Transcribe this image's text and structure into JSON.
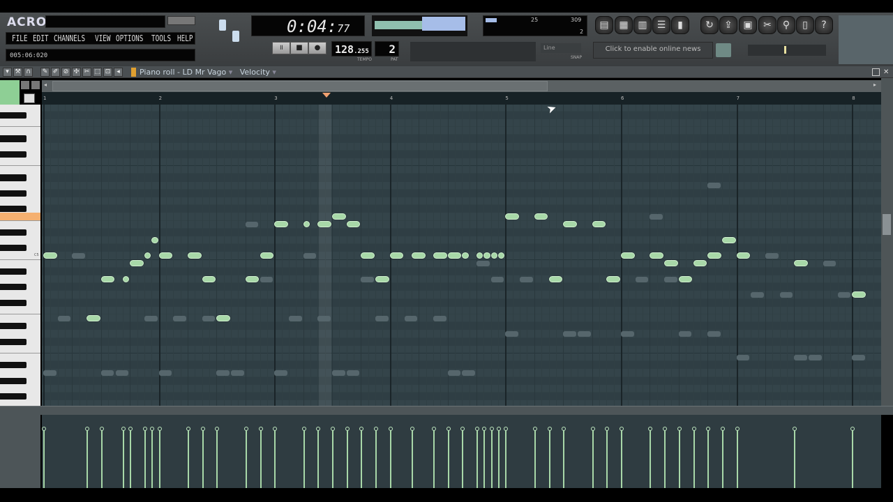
{
  "app": {
    "logo": "ACRO",
    "menu": [
      "FILE",
      "EDIT",
      "CHANNELS",
      "VIEW",
      "OPTIONS",
      "TOOLS",
      "HELP"
    ],
    "hint": "005:06:020"
  },
  "transport": {
    "time_main": "0:04:",
    "time_sub": "77",
    "tempo": "128",
    "tempo_frac": ".255",
    "tempo_label": "TEMPO",
    "pattern": "2",
    "pattern_label": "PAT",
    "snap": "Line",
    "snap_label": "SNAP",
    "cpu": "25",
    "poly": "309",
    "mem": "2"
  },
  "news": {
    "label": "Click to enable online news"
  },
  "piano_roll": {
    "title": "Piano roll - LD Mr Vago",
    "target": "Velocity",
    "bars": [
      "1",
      "2",
      "3",
      "4",
      "5",
      "6",
      "7",
      "8"
    ],
    "playhead_step": 39,
    "highlighted_key": "F5",
    "key_label": "C5",
    "note_color": "#a8d8a8",
    "notes": [
      [
        0,
        2,
        "C5"
      ],
      [
        6,
        2,
        "E4"
      ],
      [
        8,
        2,
        "A4"
      ],
      [
        11,
        1,
        "A4"
      ],
      [
        12,
        2,
        "B4"
      ],
      [
        14,
        1,
        "C5"
      ],
      [
        15,
        1,
        "D5"
      ],
      [
        16,
        2,
        "C5"
      ],
      [
        20,
        2,
        "C5"
      ],
      [
        22,
        2,
        "A4"
      ],
      [
        24,
        2,
        "E4"
      ],
      [
        28,
        2,
        "A4"
      ],
      [
        30,
        2,
        "C5"
      ],
      [
        32,
        2,
        "E5"
      ],
      [
        36,
        1,
        "E5"
      ],
      [
        38,
        2,
        "E5"
      ],
      [
        40,
        2,
        "F5"
      ],
      [
        42,
        2,
        "E5"
      ],
      [
        44,
        2,
        "C5"
      ],
      [
        46,
        2,
        "A4"
      ],
      [
        48,
        2,
        "C5"
      ],
      [
        51,
        2,
        "C5"
      ],
      [
        54,
        2,
        "C5"
      ],
      [
        56,
        2,
        "C5"
      ],
      [
        58,
        1,
        "C5"
      ],
      [
        60,
        1,
        "C5"
      ],
      [
        61,
        1,
        "C5"
      ],
      [
        62,
        1,
        "C5"
      ],
      [
        63,
        1,
        "C5"
      ],
      [
        64,
        2,
        "F5"
      ],
      [
        68,
        2,
        "F5"
      ],
      [
        70,
        2,
        "A4"
      ],
      [
        72,
        2,
        "E5"
      ],
      [
        76,
        2,
        "E5"
      ],
      [
        78,
        2,
        "A4"
      ],
      [
        80,
        2,
        "C5"
      ],
      [
        84,
        2,
        "C5"
      ],
      [
        86,
        2,
        "B4"
      ],
      [
        88,
        2,
        "A4"
      ],
      [
        90,
        2,
        "B4"
      ],
      [
        92,
        2,
        "C5"
      ],
      [
        94,
        2,
        "D5"
      ],
      [
        96,
        2,
        "C5"
      ],
      [
        104,
        2,
        "B4"
      ],
      [
        112,
        2,
        "G4"
      ]
    ],
    "ghost_notes": [
      [
        92,
        2,
        "A5"
      ],
      [
        84,
        2,
        "F5"
      ],
      [
        28,
        2,
        "E5"
      ],
      [
        4,
        2,
        "C5"
      ],
      [
        36,
        2,
        "C5"
      ],
      [
        100,
        2,
        "C5"
      ],
      [
        60,
        2,
        "B4"
      ],
      [
        108,
        2,
        "B4"
      ],
      [
        30,
        2,
        "A4"
      ],
      [
        44,
        2,
        "A4"
      ],
      [
        62,
        2,
        "A4"
      ],
      [
        66,
        2,
        "A4"
      ],
      [
        82,
        2,
        "A4"
      ],
      [
        86,
        2,
        "A4"
      ],
      [
        98,
        2,
        "G4"
      ],
      [
        102,
        2,
        "G4"
      ],
      [
        110,
        2,
        "G4"
      ],
      [
        2,
        2,
        "E4"
      ],
      [
        14,
        2,
        "E4"
      ],
      [
        18,
        2,
        "E4"
      ],
      [
        22,
        2,
        "E4"
      ],
      [
        34,
        2,
        "E4"
      ],
      [
        38,
        2,
        "E4"
      ],
      [
        46,
        2,
        "E4"
      ],
      [
        50,
        2,
        "E4"
      ],
      [
        54,
        2,
        "E4"
      ],
      [
        64,
        2,
        "D4"
      ],
      [
        72,
        2,
        "D4"
      ],
      [
        74,
        2,
        "D4"
      ],
      [
        80,
        2,
        "D4"
      ],
      [
        88,
        2,
        "D4"
      ],
      [
        92,
        2,
        "D4"
      ],
      [
        96,
        2,
        "B3"
      ],
      [
        104,
        2,
        "B3"
      ],
      [
        106,
        2,
        "B3"
      ],
      [
        112,
        2,
        "B3"
      ],
      [
        0,
        2,
        "A3"
      ],
      [
        8,
        2,
        "A3"
      ],
      [
        10,
        2,
        "A3"
      ],
      [
        16,
        2,
        "A3"
      ],
      [
        24,
        2,
        "A3"
      ],
      [
        26,
        2,
        "A3"
      ],
      [
        32,
        2,
        "A3"
      ],
      [
        40,
        2,
        "A3"
      ],
      [
        42,
        2,
        "A3"
      ],
      [
        56,
        2,
        "A3"
      ],
      [
        58,
        2,
        "A3"
      ]
    ],
    "velocity": 1.0
  }
}
